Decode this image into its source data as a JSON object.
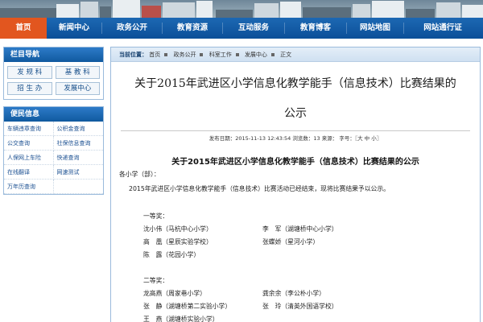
{
  "nav": {
    "items": [
      "首页",
      "新闻中心",
      "政务公开",
      "教育资源",
      "互动服务",
      "教育博客",
      "网站地图",
      "网站通行证"
    ],
    "active_index": 0,
    "active_color": "#e2561f",
    "bar_color": "#0b4f98"
  },
  "sidebar": {
    "column_nav": {
      "title": "栏目导航",
      "items": [
        "发 规 科",
        "基 教 科",
        "招 生 办",
        "发展中心"
      ]
    },
    "convenience": {
      "title": "便民信息",
      "items": [
        "车辆违章查询",
        "公积金查询",
        "公交查询",
        "社保信息查询",
        "人保网上车险",
        "快递查询",
        "在线翻译",
        "网速测试",
        "万年历查询"
      ]
    }
  },
  "breadcrumb": {
    "label": "当前位置：",
    "items": [
      "首页",
      "政务公开",
      "科室工作",
      "发展中心",
      "正文"
    ]
  },
  "article": {
    "title_line1": "关于2015年武进区小学信息化教学能手（信息技术）比赛结果的",
    "title_line2": "公示",
    "meta": {
      "date_label": "发布日期：",
      "date": "2015-11-13 12:43:54",
      "views_label": "浏览数：",
      "views": "13",
      "close": "来源：",
      "font_label": "字号：",
      "font_open": "〖",
      "size_large": "大",
      "size_medium": "中",
      "size_small": "小",
      "font_close": "〗"
    },
    "heading": "关于2015年武进区小学信息化教学能手（信息技术）比赛结果的公示",
    "salutation": "各小学（部）：",
    "intro": "2015年武进区小学信息化教学能手（信息技术）比赛活动已经结束，现将比赛结果予以公示。",
    "first_prize": {
      "label": "一等奖：",
      "rows": [
        [
          "沈小伟（马杭中心小学）",
          "李　军（湖塘桥中心小学）"
        ],
        [
          "高　凰（星辰实验学校）",
          "张蝶娇（星河小学）"
        ],
        [
          "陈　露（花园小学）",
          ""
        ]
      ]
    },
    "second_prize": {
      "label": "二等奖：",
      "rows": [
        [
          "龙高燕（周家巷小学）",
          "龚余余（李公朴小学）"
        ],
        [
          "张　静（湖塘桥第二实验小学）",
          "张　玲（清英外国语学校）"
        ],
        [
          "王　燕（湖塘桥实验小学）",
          ""
        ]
      ]
    }
  }
}
